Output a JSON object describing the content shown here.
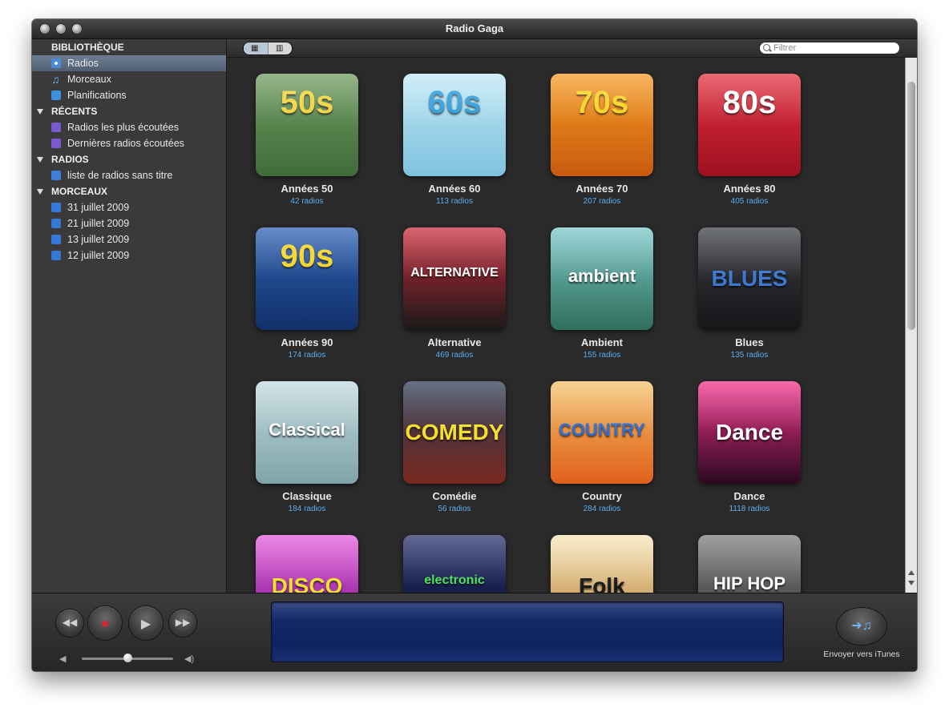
{
  "window": {
    "title": "Radio Gaga"
  },
  "sidebar": {
    "sections": [
      {
        "title": "BIBLIOTHÈQUE"
      },
      {
        "title": "RÉCENTS"
      },
      {
        "title": "RADIOS"
      },
      {
        "title": "MORCEAUX"
      }
    ],
    "library": [
      {
        "label": "Radios",
        "icon": "radio-icon"
      },
      {
        "label": "Morceaux",
        "icon": "music-note-icon"
      },
      {
        "label": "Planifications",
        "icon": "schedule-icon"
      }
    ],
    "recent": [
      {
        "label": "Radios les plus écoutées",
        "icon": "radio-stream-icon"
      },
      {
        "label": "Dernières radios écoutées",
        "icon": "radio-stream-icon"
      }
    ],
    "radios": [
      {
        "label": "liste de radios sans titre",
        "icon": "radio-list-icon"
      }
    ],
    "tracks": [
      {
        "label": "31 juillet 2009",
        "icon": "track-icon"
      },
      {
        "label": "21 juillet 2009",
        "icon": "track-icon"
      },
      {
        "label": "13 juillet 2009",
        "icon": "track-icon"
      },
      {
        "label": "12 juillet 2009",
        "icon": "track-icon"
      }
    ],
    "bottom": {
      "add": "+",
      "remove": "−"
    }
  },
  "search": {
    "placeholder": "Filtrer"
  },
  "genres": [
    {
      "name": "Années 50",
      "count": "42 radios",
      "art": "50s",
      "bg1": "#6e9a5e",
      "bg2": "#3f6c3a",
      "fg": "#f3d23a"
    },
    {
      "name": "Années 60",
      "count": "113 radios",
      "art": "60s",
      "bg1": "#bfe7f4",
      "bg2": "#7fc2de",
      "fg": "#2a9bd8"
    },
    {
      "name": "Années 70",
      "count": "207 radios",
      "art": "70s",
      "bg1": "#f59a22",
      "bg2": "#c85a10",
      "fg": "#f7d21a"
    },
    {
      "name": "Années 80",
      "count": "405 radios",
      "art": "80s",
      "bg1": "#e23040",
      "bg2": "#9e1020",
      "fg": "#ffffff"
    },
    {
      "name": "Années 90",
      "count": "174 radios",
      "art": "90s",
      "bg1": "#2d5fb0",
      "bg2": "#12306a",
      "fg": "#f4d21e"
    },
    {
      "name": "Alternative",
      "count": "469 radios",
      "art": "ALTERNATIVE",
      "bg1": "#c8283a",
      "bg2": "#1a1a1a",
      "fg": "#ffffff"
    },
    {
      "name": "Ambient",
      "count": "155 radios",
      "art": "ambient",
      "bg1": "#7ac6c8",
      "bg2": "#2f6e5a",
      "fg": "#ffffff"
    },
    {
      "name": "Blues",
      "count": "135 radios",
      "art": "BLUES",
      "bg1": "#3a3d44",
      "bg2": "#151618",
      "fg": "#3d78d0"
    },
    {
      "name": "Classique",
      "count": "184 radios",
      "art": "Classical",
      "bg1": "#bfd8dc",
      "bg2": "#7fa4aa",
      "fg": "#ffffff"
    },
    {
      "name": "Comédie",
      "count": "56 radios",
      "art": "COMEDY",
      "bg1": "#2a3a52",
      "bg2": "#7a2a20",
      "fg": "#f3e02a"
    },
    {
      "name": "Country",
      "count": "284 radios",
      "art": "COUNTRY",
      "bg1": "#f2c06a",
      "bg2": "#e0601a",
      "fg": "#2f6ed0"
    },
    {
      "name": "Dance",
      "count": "1118 radios",
      "art": "Dance",
      "bg1": "#f22f8a",
      "bg2": "#2a0a20",
      "fg": "#ffffff"
    },
    {
      "name": "Disco",
      "count": "",
      "art": "DISCO",
      "bg1": "#e35ad8",
      "bg2": "#7a1a90",
      "fg": "#f3e02a"
    },
    {
      "name": "Electronic",
      "count": "",
      "art": "electronic",
      "bg1": "#26306a",
      "bg2": "#0c1030",
      "fg": "#49e05a"
    },
    {
      "name": "Folk",
      "count": "",
      "art": "Folk",
      "bg1": "#f7e4b8",
      "bg2": "#b8823a",
      "fg": "#1a1a1a"
    },
    {
      "name": "Hip Hop",
      "count": "",
      "art": "HIP HOP",
      "bg1": "#7a7a7a",
      "bg2": "#3a3a3a",
      "fg": "#ffffff"
    }
  ],
  "player": {
    "rewind_icon": "rewind-icon",
    "record_icon": "record-icon",
    "play_icon": "play-icon",
    "forward_icon": "fast-forward-icon",
    "volume_fraction": 0.5,
    "send_to_itunes": "Envoyer vers iTunes",
    "accent": "#1c2f72"
  }
}
